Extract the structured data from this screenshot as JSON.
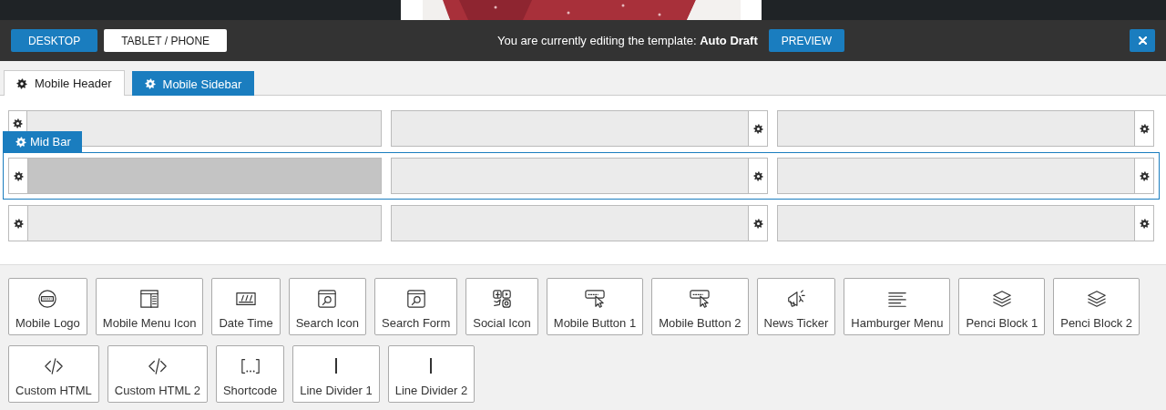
{
  "toolbar": {
    "view_buttons": [
      {
        "label": "DESKTOP",
        "selected": true
      },
      {
        "label": "TABLET / PHONE",
        "selected": false
      }
    ],
    "notice": "You are currently editing the template: **Auto Draft**",
    "preview_button": "PREVIEW"
  },
  "tabs": [
    {
      "label": "Mobile Header",
      "selected": true
    },
    {
      "label": "Mobile Sidebar",
      "selected": false
    }
  ],
  "rows": [
    {
      "active": false,
      "slots": [
        {
          "highlighted": false
        },
        {
          "highlighted": false
        },
        {
          "highlighted": false
        }
      ]
    },
    {
      "label": "Mid Bar",
      "active": true,
      "slots": [
        {
          "highlighted": true
        },
        {
          "highlighted": false
        },
        {
          "highlighted": false
        }
      ]
    },
    {
      "active": false,
      "slots": [
        {
          "highlighted": false
        },
        {
          "highlighted": false
        },
        {
          "highlighted": false
        }
      ]
    }
  ],
  "elements": [
    {
      "label": "Mobile Logo"
    },
    {
      "label": "Mobile Menu Icon"
    },
    {
      "label": "Date Time"
    },
    {
      "label": "Search Icon"
    },
    {
      "label": "Search Form"
    },
    {
      "label": "Social Icon"
    },
    {
      "label": "Mobile Button 1"
    },
    {
      "label": "Mobile Button 2"
    },
    {
      "label": "News Ticker"
    },
    {
      "label": "Hamburger Menu"
    },
    {
      "label": "Penci Block 1"
    },
    {
      "label": "Penci Block 2"
    },
    {
      "label": "Custom HTML"
    },
    {
      "label": "Custom HTML 2"
    },
    {
      "label": "Shortcode"
    },
    {
      "label": "Line Divider 1"
    },
    {
      "label": "Line Divider 2"
    }
  ]
}
